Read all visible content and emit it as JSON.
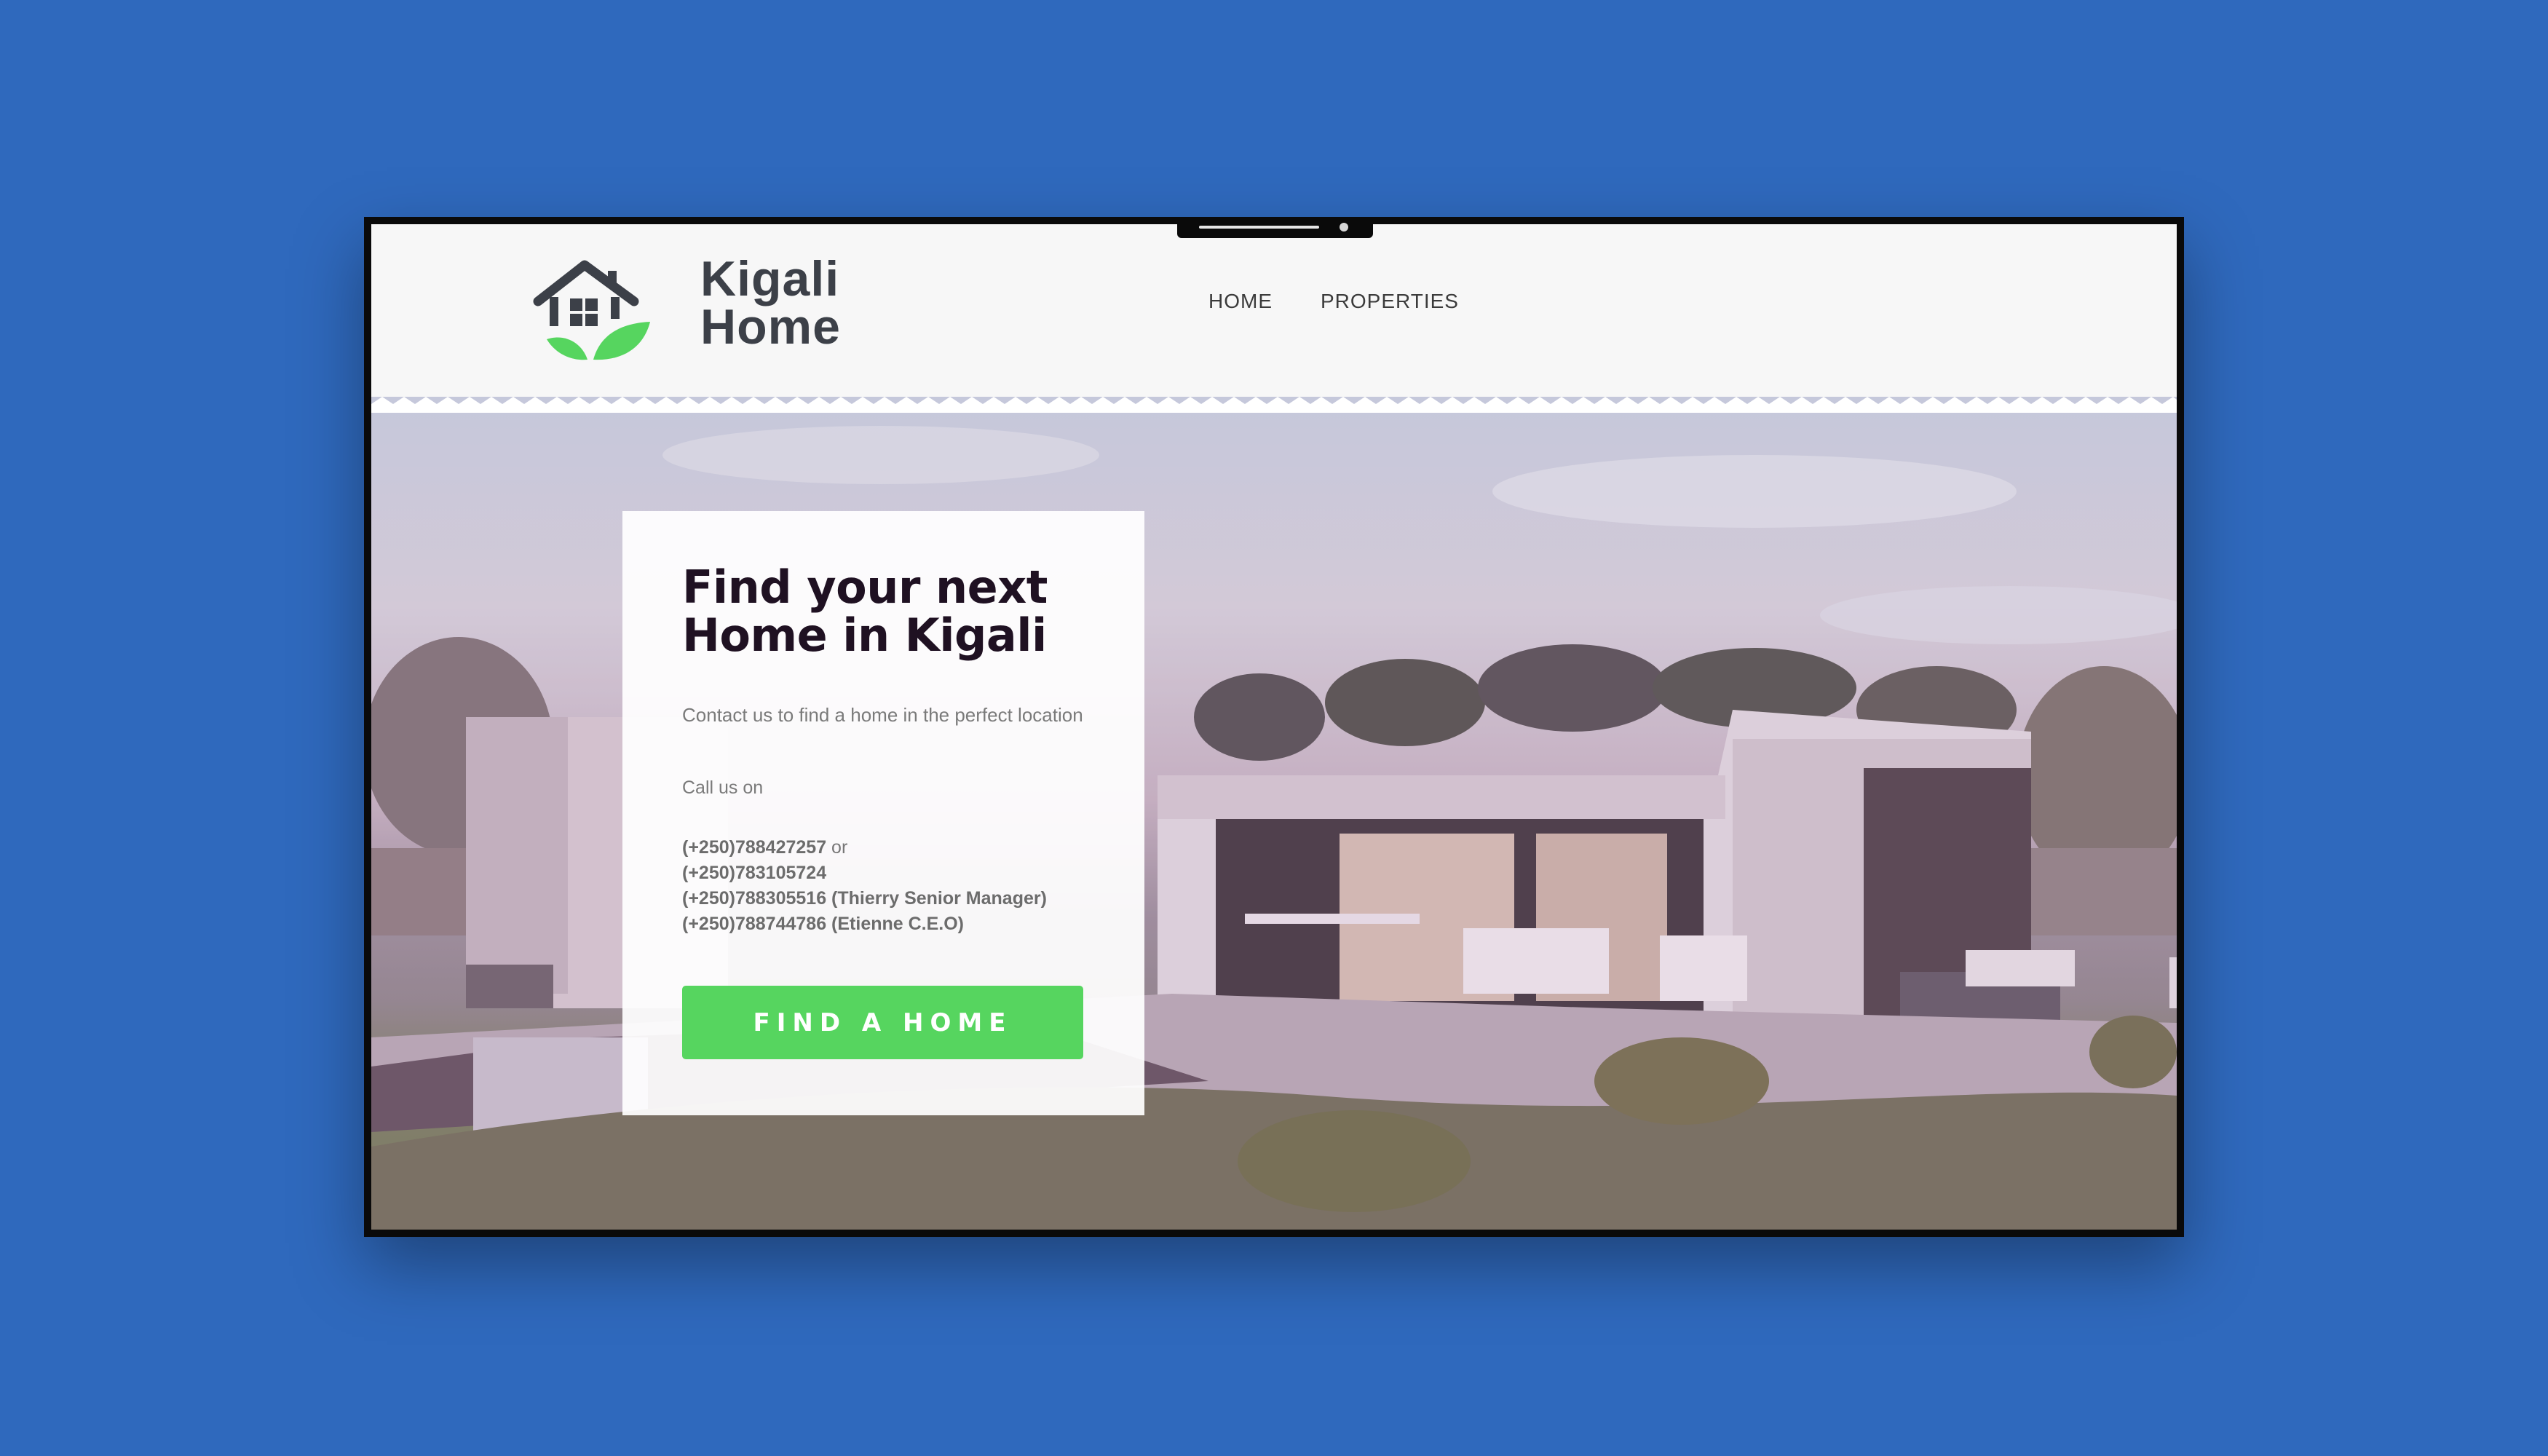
{
  "brand": {
    "name_line1": "Kigali",
    "name_line2": "Home",
    "logo": "house-with-leaves-icon"
  },
  "nav": {
    "items": [
      "HOME",
      "PROPERTIES"
    ]
  },
  "hero": {
    "title_line1": "Find your next",
    "title_line2": "Home in Kigali",
    "subtitle": "Contact us to find a home in the perfect location",
    "call_label": "Call us on",
    "phones": [
      {
        "number": "(+250)788427257",
        "suffix": " or"
      },
      {
        "number": "(+250)783105724",
        "suffix": ""
      },
      {
        "number": "(+250)788305516 (Thierry Senior Manager)",
        "suffix": ""
      },
      {
        "number": "(+250)788744786 (Etienne C.E.O)",
        "suffix": ""
      }
    ],
    "cta_label": "FIND A HOME"
  },
  "colors": {
    "background": "#2f69bd",
    "accent": "#56d55f",
    "logo_dark": "#3c4048"
  }
}
